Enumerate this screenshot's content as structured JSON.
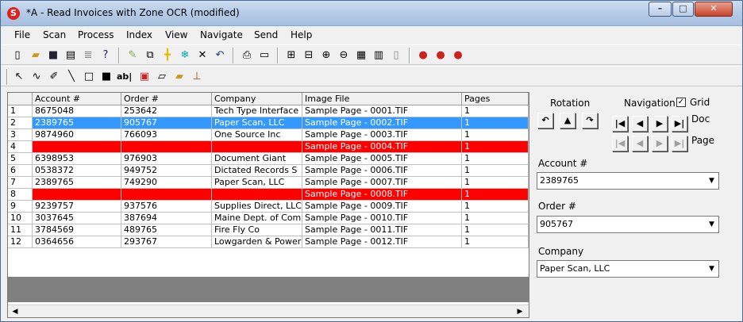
{
  "window": {
    "title": "*A - Read Invoices with Zone OCR (modified)",
    "min": "–",
    "max": "□",
    "close": "✕"
  },
  "menu": [
    "File",
    "Scan",
    "Process",
    "Index",
    "View",
    "Navigate",
    "Send",
    "Help"
  ],
  "grid": {
    "columns": [
      "Account #",
      "Order #",
      "Company",
      "Image File",
      "Pages"
    ],
    "rows": [
      {
        "n": "1",
        "account": "8675048",
        "order": "253642",
        "company": "Tech Type Interface",
        "image": "Sample Page - 0001.TIF",
        "pages": "1"
      },
      {
        "n": "2",
        "account": "2389765",
        "order": "905767",
        "company": "Paper Scan, LLC",
        "image": "Sample Page - 0002.TIF",
        "pages": "1"
      },
      {
        "n": "3",
        "account": "9874960",
        "order": "766093",
        "company": "One Source Inc",
        "image": "Sample Page - 0003.TIF",
        "pages": "1"
      },
      {
        "n": "4",
        "account": "",
        "order": "",
        "company": "",
        "image": "Sample Page - 0004.TIF",
        "pages": "1"
      },
      {
        "n": "5",
        "account": "6398953",
        "order": "976903",
        "company": "Document Giant",
        "image": "Sample Page - 0005.TIF",
        "pages": "1"
      },
      {
        "n": "6",
        "account": "0538372",
        "order": "949752",
        "company": "Dictated Records S",
        "image": "Sample Page - 0006.TIF",
        "pages": "1"
      },
      {
        "n": "7",
        "account": "2389765",
        "order": "749290",
        "company": "Paper Scan, LLC",
        "image": "Sample Page - 0007.TIF",
        "pages": "1"
      },
      {
        "n": "8",
        "account": "",
        "order": "",
        "company": "",
        "image": "Sample Page - 0008.TIF",
        "pages": "1"
      },
      {
        "n": "9",
        "account": "9239757",
        "order": "937576",
        "company": "Supplies Direct, LLC",
        "image": "Sample Page - 0009.TIF",
        "pages": "1"
      },
      {
        "n": "10",
        "account": "3037645",
        "order": "387694",
        "company": "Maine Dept. of Com",
        "image": "Sample Page - 0010.TIF",
        "pages": "1"
      },
      {
        "n": "11",
        "account": "3784569",
        "order": "489765",
        "company": "Fire Fly Co",
        "image": "Sample Page - 0011.TIF",
        "pages": "1"
      },
      {
        "n": "12",
        "account": "0364656",
        "order": "293767",
        "company": "Lowgarden & Power",
        "image": "Sample Page - 0012.TIF",
        "pages": "1"
      }
    ]
  },
  "panel": {
    "rotation_label": "Rotation",
    "navigation_label": "Navigation",
    "grid_label": "Grid",
    "grid_checked": "✓",
    "doc_label": "Doc",
    "page_label": "Page",
    "account_label": "Account #",
    "account_value": "2389765",
    "order_label": "Order #",
    "order_value": "905767",
    "company_label": "Company",
    "company_value": "Paper Scan, LLC"
  },
  "colors": {
    "selected": "#3399ff",
    "error_row": "#ff0000"
  }
}
